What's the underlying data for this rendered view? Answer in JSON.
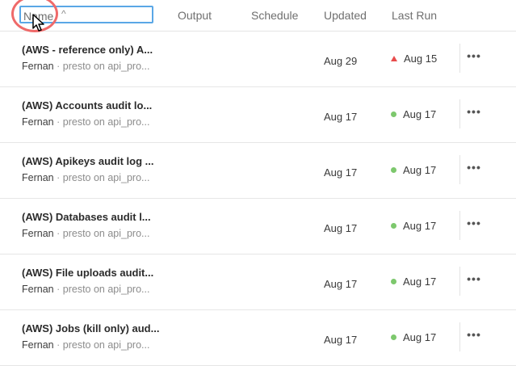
{
  "header": {
    "name": "Name",
    "output": "Output",
    "schedule": "Schedule",
    "updated": "Updated",
    "last_run": "Last Run",
    "sort_icon": "^"
  },
  "rows": [
    {
      "title": "(AWS - reference only) A...",
      "owner": "Fernan",
      "sep": "·",
      "meta": "presto on api_pro...",
      "updated": "Aug 29",
      "last_run": "Aug 15",
      "status": "failed",
      "more": "•••"
    },
    {
      "title": "(AWS) Accounts audit lo...",
      "owner": "Fernan",
      "sep": "·",
      "meta": "presto on api_pro...",
      "updated": "Aug 17",
      "last_run": "Aug 17",
      "status": "success",
      "more": "•••"
    },
    {
      "title": "(AWS) Apikeys audit log ...",
      "owner": "Fernan",
      "sep": "·",
      "meta": "presto on api_pro...",
      "updated": "Aug 17",
      "last_run": "Aug 17",
      "status": "success",
      "more": "•••"
    },
    {
      "title": "(AWS) Databases audit l...",
      "owner": "Fernan",
      "sep": "·",
      "meta": "presto on api_pro...",
      "updated": "Aug 17",
      "last_run": "Aug 17",
      "status": "success",
      "more": "•••"
    },
    {
      "title": "(AWS) File uploads audit...",
      "owner": "Fernan",
      "sep": "·",
      "meta": "presto on api_pro...",
      "updated": "Aug 17",
      "last_run": "Aug 17",
      "status": "success",
      "more": "•••"
    },
    {
      "title": "(AWS) Jobs (kill only) aud...",
      "owner": "Fernan",
      "sep": "·",
      "meta": "presto on api_pro...",
      "updated": "Aug 17",
      "last_run": "Aug 17",
      "status": "success",
      "more": "•••"
    }
  ],
  "colors": {
    "success": "#7dc86d",
    "failed": "#e84c4c",
    "focus": "#5aa7e6",
    "highlight": "#ef6a6a"
  },
  "icons": {
    "sort": "sort-asc-icon",
    "cursor": "mouse-pointer-icon",
    "more": "more-horizontal-icon",
    "success": "success-dot-icon",
    "failed": "failed-triangle-icon"
  }
}
